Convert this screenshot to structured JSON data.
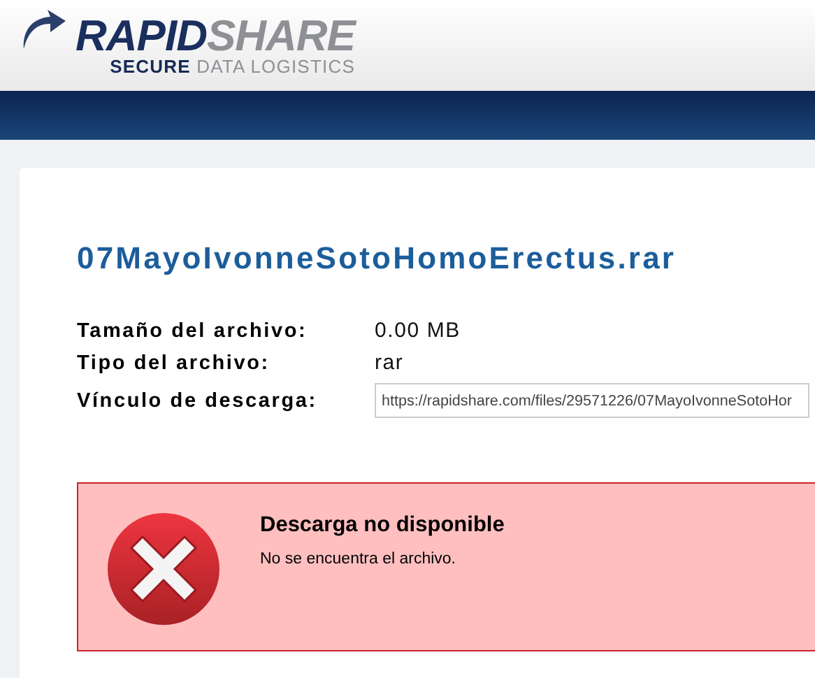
{
  "logo": {
    "brand_strong": "RAPID",
    "brand_light": "SHARE",
    "tagline_strong": "SECURE",
    "tagline_light": "DATA LOGISTICS"
  },
  "file": {
    "name": "07MayoIvonneSotoHomoErectus.rar",
    "details": [
      {
        "label": "Tamaño del archivo:",
        "value": "0.00 MB",
        "kind": "text"
      },
      {
        "label": "Tipo del archivo:",
        "value": "rar",
        "kind": "text"
      },
      {
        "label": "Vínculo de descarga:",
        "value": "https://rapidshare.com/files/29571226/07MayoIvonneSotoHor",
        "kind": "field"
      }
    ]
  },
  "error": {
    "title": "Descarga no disponible",
    "message": "No se encuentra el archivo."
  }
}
